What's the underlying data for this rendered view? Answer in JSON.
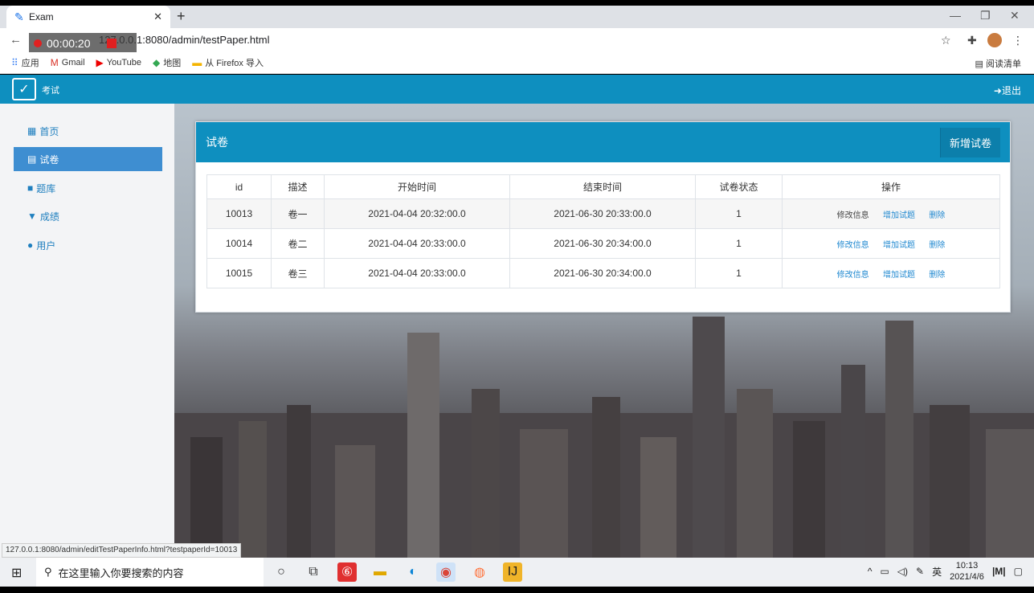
{
  "browser": {
    "tab_title": "Exam",
    "url": "127.0.0.1:8080/admin/testPaper.html",
    "recording_time": "00:00:20",
    "bookmarks": [
      "应用",
      "Gmail",
      "YouTube",
      "地图",
      "从 Firefox 导入"
    ],
    "reading_list": "阅读清单",
    "status_url": "127.0.0.1:8080/admin/editTestPaperInfo.html?testpaperId=10013"
  },
  "app": {
    "title": "考试",
    "logout": "退出"
  },
  "sidebar": {
    "items": [
      {
        "label": "首页",
        "icon": "grid-icon"
      },
      {
        "label": "试卷",
        "icon": "list-icon"
      },
      {
        "label": "题库",
        "icon": "folder-icon"
      },
      {
        "label": "成绩",
        "icon": "filter-icon"
      },
      {
        "label": "用户",
        "icon": "user-icon"
      }
    ]
  },
  "panel": {
    "title": "试卷",
    "add_button": "新增试卷"
  },
  "table": {
    "headers": [
      "id",
      "描述",
      "开始时间",
      "结束时间",
      "试卷状态",
      "操作"
    ],
    "rows": [
      {
        "id": "10013",
        "desc": "卷一",
        "start": "2021-04-04 20:32:00.0",
        "end": "2021-06-30 20:33:00.0",
        "status": "1"
      },
      {
        "id": "10014",
        "desc": "卷二",
        "start": "2021-04-04 20:33:00.0",
        "end": "2021-06-30 20:34:00.0",
        "status": "1"
      },
      {
        "id": "10015",
        "desc": "卷三",
        "start": "2021-04-04 20:33:00.0",
        "end": "2021-06-30 20:34:00.0",
        "status": "1"
      }
    ],
    "actions": {
      "edit": "修改信息",
      "add_question": "增加试题",
      "delete": "删除"
    }
  },
  "taskbar": {
    "search_placeholder": "在这里输入你要搜索的内容",
    "ime": "英",
    "time": "10:13",
    "date": "2021/4/6"
  },
  "colors": {
    "primary": "#0e8fbf",
    "sidebar_active": "#3e8ed1",
    "link": "#1f88d0"
  }
}
